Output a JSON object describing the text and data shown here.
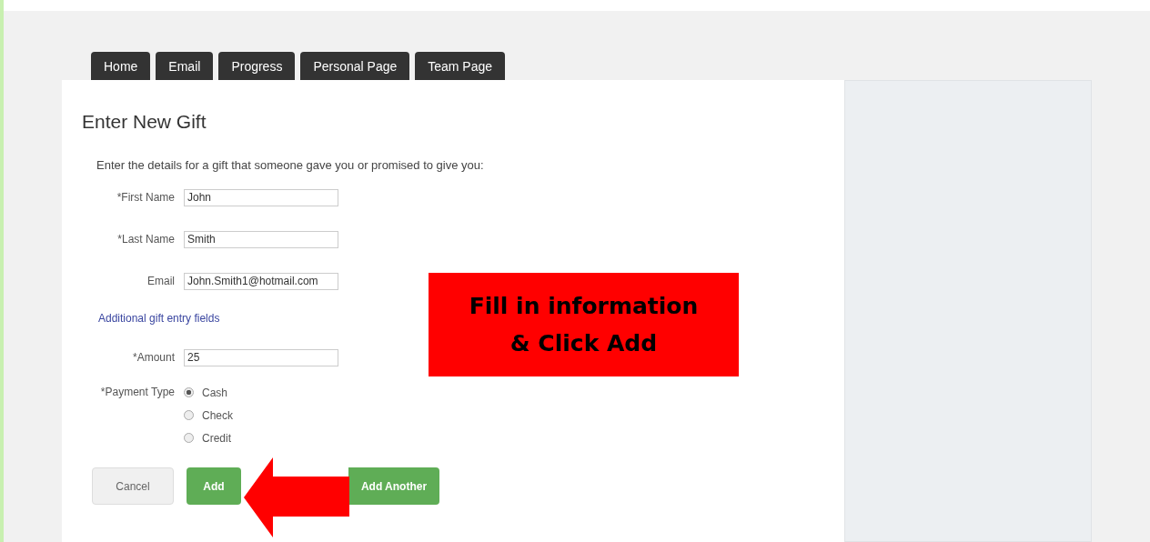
{
  "tabs": [
    {
      "label": "Home",
      "selected": false
    },
    {
      "label": "Email",
      "selected": false
    },
    {
      "label": "Progress",
      "selected": false
    },
    {
      "label": "Personal Page",
      "selected": false
    },
    {
      "label": "Team Page",
      "selected": false
    }
  ],
  "form": {
    "title": "Enter New Gift",
    "intro": "Enter the details for a gift that someone gave you or promised to give you:",
    "fields": [
      {
        "label": "*First Name",
        "value": "John"
      },
      {
        "label": "*Last Name",
        "value": "Smith"
      },
      {
        "label": "Email",
        "value": "John.Smith1@hotmail.com"
      }
    ],
    "link": "Additional gift entry fields",
    "amount": {
      "label": "*Amount",
      "value": "25"
    },
    "payment": {
      "label": "*Payment Type",
      "options": [
        {
          "label": "Cash",
          "selected": true
        },
        {
          "label": "Check",
          "selected": false
        },
        {
          "label": "Credit",
          "selected": false
        }
      ]
    },
    "buttons": [
      {
        "label": "Cancel",
        "kind": "secondary"
      },
      {
        "label": "Add",
        "kind": "primary"
      },
      {
        "label": "Add Another",
        "kind": "primary"
      }
    ]
  },
  "callout": {
    "lines": [
      "Fill in information",
      "& Click Add"
    ]
  }
}
